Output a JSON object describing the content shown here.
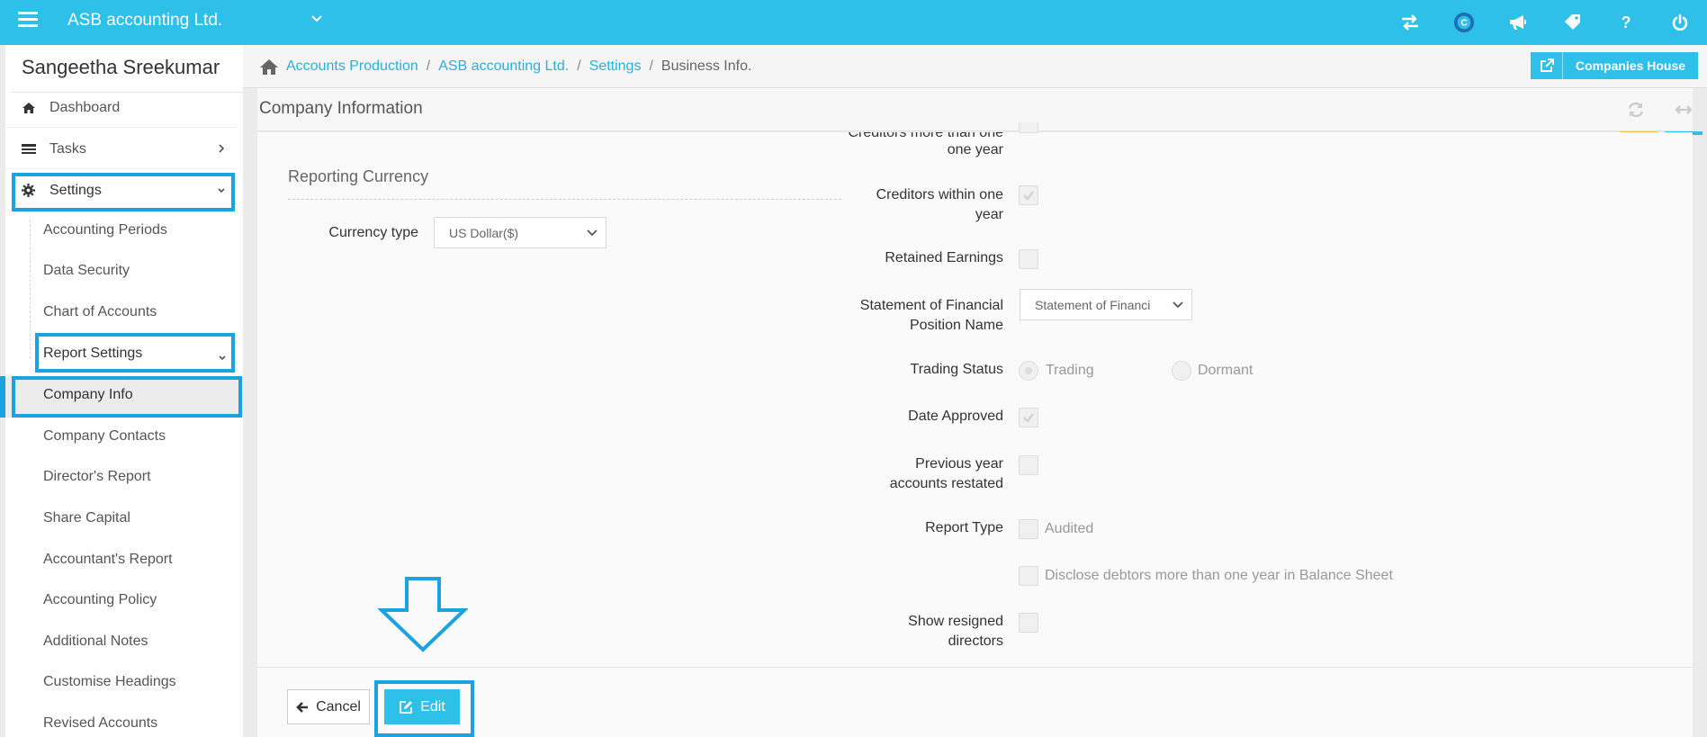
{
  "topbar": {
    "company": "ASB accounting Ltd.",
    "icons": [
      "swap-icon",
      "c-logo-icon",
      "megaphone-icon",
      "tag-icon",
      "help-icon",
      "power-icon"
    ],
    "accent": "#2ec0e8"
  },
  "sidebar": {
    "user_name": "Sangeetha Sreekumar",
    "items": [
      {
        "label": "Dashboard",
        "icon": "home-icon"
      },
      {
        "label": "Tasks",
        "icon": "list-icon"
      },
      {
        "label": "Settings",
        "icon": "gear-icon"
      }
    ],
    "sub_items": [
      {
        "label": "Accounting Periods"
      },
      {
        "label": "Data Security"
      },
      {
        "label": "Chart of Accounts"
      },
      {
        "label": "Report Settings"
      },
      {
        "label": "Company Info"
      },
      {
        "label": "Company Contacts"
      },
      {
        "label": "Director's Report"
      },
      {
        "label": "Share Capital"
      },
      {
        "label": "Accountant's Report"
      },
      {
        "label": "Accounting Policy"
      },
      {
        "label": "Additional Notes"
      },
      {
        "label": "Customise Headings"
      },
      {
        "label": "Revised Accounts"
      }
    ],
    "highlight_color": "#1aa3e0"
  },
  "breadcrumb": {
    "items": [
      "Accounts Production",
      "ASB accounting Ltd.",
      "Settings"
    ],
    "separator": "/",
    "current": "Business Info."
  },
  "companies_house_button": "Companies House",
  "panel": {
    "title": "Company Information",
    "reporting": {
      "section_title": "Reporting Currency",
      "currency_label": "Currency type",
      "currency_value": "US Dollar($)"
    },
    "fields": {
      "creditors_more_than_one_year": "Creditors more than one year",
      "creditors_within_one_year_l1": "Creditors within one",
      "creditors_within_one_year_l2": "year",
      "retained_earnings": "Retained Earnings",
      "sofp_name_l1": "Statement of Financial",
      "sofp_name_l2": "Position Name",
      "sofp_value": "Statement of Financi",
      "trading_status": "Trading Status",
      "trading_option": "Trading",
      "dormant_option": "Dormant",
      "date_approved": "Date Approved",
      "prev_year_l1": "Previous year",
      "prev_year_l2": "accounts restated",
      "report_type": "Report Type",
      "audited_option": "Audited",
      "disclose_debtors": "Disclose debtors more than one year in Balance Sheet",
      "show_resigned_l1": "Show resigned",
      "show_resigned_l2": "directors"
    },
    "values": {
      "creditors_more_than_one_year": true,
      "creditors_within_one_year": true,
      "retained_earnings": false,
      "trading_status": "Trading",
      "date_approved": true,
      "prev_year_restated": false,
      "audited": false,
      "disclose_debtors": false,
      "show_resigned_directors": false
    }
  },
  "footer": {
    "cancel_label": "Cancel",
    "edit_label": "Edit"
  }
}
